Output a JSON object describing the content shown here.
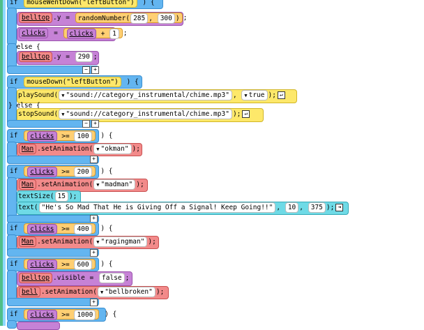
{
  "kw": {
    "if": "if",
    "else": "} else {",
    "close": "}"
  },
  "lines": {
    "l1": {
      "fn": "mouseWentDown",
      "arg": "\"leftButton\""
    },
    "l2": {
      "obj": "belltop",
      "prop": ".y",
      "op": "=",
      "fn": "randomNumber",
      "a1": "285",
      "a2": "300"
    },
    "l3": {
      "var": "clicks",
      "op": "=",
      "var2": "clicks",
      "plus": "+",
      "num": "1"
    },
    "l5": {
      "obj": "belltop",
      "prop": ".y",
      "op": "=",
      "num": "290"
    },
    "l7": {
      "fn": "mouseDown",
      "arg": "\"leftButton\""
    },
    "l8": {
      "fn": "playSound",
      "arg": "\"sound://category_instrumental/chime.mp3\"",
      "bool": "true"
    },
    "l10": {
      "fn": "stopSound",
      "arg": "\"sound://category_instrumental/chime.mp3\""
    },
    "l12": {
      "var": "clicks",
      "op": ">=",
      "num": "100"
    },
    "l13": {
      "obj": "Man",
      "fn": ".setAnimation",
      "arg": "\"okman\""
    },
    "l15": {
      "var": "clicks",
      "op": ">=",
      "num": "200"
    },
    "l16": {
      "obj": "Man",
      "fn": ".setAnimation",
      "arg": "\"madman\""
    },
    "l17": {
      "fn": "textSize",
      "num": "15"
    },
    "l18": {
      "fn": "text",
      "arg": "\"He's So Mad That He is Giving Off a Signal! Keep Going!!\"",
      "a1": "10",
      "a2": "375"
    },
    "l20": {
      "var": "clicks",
      "op": ">=",
      "num": "400"
    },
    "l21": {
      "obj": "Man",
      "fn": ".setAnimation",
      "arg": "\"ragingman\""
    },
    "l23": {
      "var": "clicks",
      "op": ">=",
      "num": "600"
    },
    "l24": {
      "obj": "belltop",
      "prop": ".visible",
      "op": "=",
      "bool": "false"
    },
    "l25": {
      "obj": "bell",
      "fn": ".setAnimation",
      "arg": "\"bellbroken\""
    },
    "l27": {
      "var": "clicks",
      "op": ">=",
      "num": "1000"
    }
  },
  "glyphs": {
    "dropdown": "▼",
    "plus": "+",
    "minus": "−",
    "enter": "↵",
    "enter2": "⇥"
  },
  "colors": {
    "control": "#63b5f0",
    "variable": "#c682d6",
    "game": "#fde86a",
    "sprite": "#f28a8a",
    "text": "#6fdae6"
  }
}
